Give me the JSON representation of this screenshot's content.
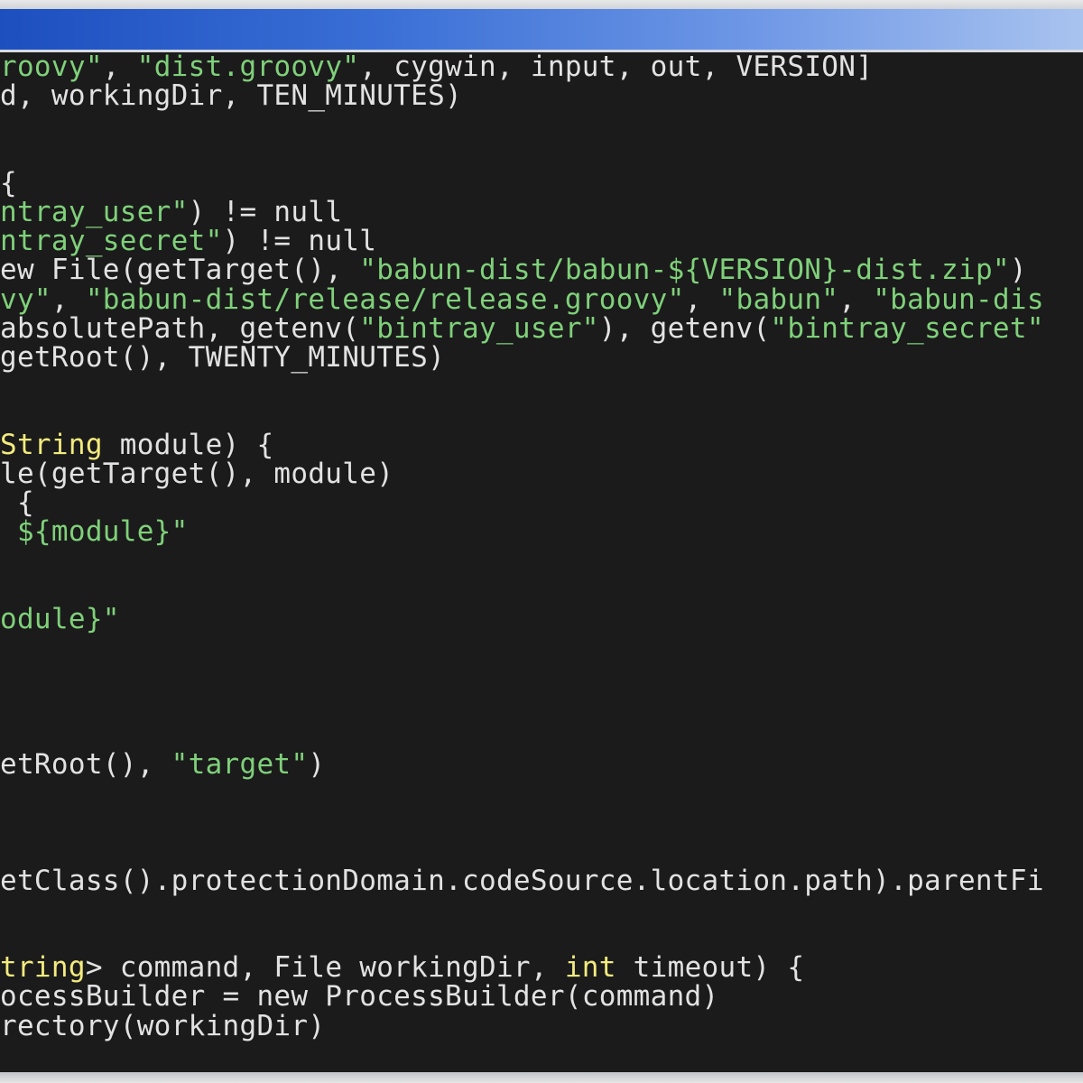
{
  "window": {
    "title": ""
  },
  "colors": {
    "background": "#1b1b1b",
    "default_text": "#e2e2e2",
    "string": "#7fd07a",
    "keyword": "#f3eb7d",
    "titlebar_accent": "#1d4fbf"
  },
  "code_lines": [
    [
      {
        "t": "roovy\"",
        "c": "str"
      },
      {
        "t": ", ",
        "c": "plain"
      },
      {
        "t": "\"dist.groovy\"",
        "c": "str"
      },
      {
        "t": ", cygwin, input, out, VERSION]",
        "c": "plain"
      }
    ],
    [
      {
        "t": "d, workingDir, TEN_MINUTES)",
        "c": "plain"
      }
    ],
    [
      {
        "t": "",
        "c": "plain"
      }
    ],
    [
      {
        "t": "",
        "c": "plain"
      }
    ],
    [
      {
        "t": "{",
        "c": "plain"
      }
    ],
    [
      {
        "t": "ntray_user\"",
        "c": "str"
      },
      {
        "t": ") != null",
        "c": "plain"
      }
    ],
    [
      {
        "t": "ntray_secret\"",
        "c": "str"
      },
      {
        "t": ") != null",
        "c": "plain"
      }
    ],
    [
      {
        "t": "ew File(getTarget(), ",
        "c": "plain"
      },
      {
        "t": "\"babun-dist/babun-${VERSION}-dist.zip\"",
        "c": "str"
      },
      {
        "t": ")",
        "c": "plain"
      }
    ],
    [
      {
        "t": "vy\"",
        "c": "str"
      },
      {
        "t": ", ",
        "c": "plain"
      },
      {
        "t": "\"babun-dist/release/release.groovy\"",
        "c": "str"
      },
      {
        "t": ", ",
        "c": "plain"
      },
      {
        "t": "\"babun\"",
        "c": "str"
      },
      {
        "t": ", ",
        "c": "plain"
      },
      {
        "t": "\"babun-dis",
        "c": "str"
      }
    ],
    [
      {
        "t": "absolutePath, getenv(",
        "c": "plain"
      },
      {
        "t": "\"bintray_user\"",
        "c": "str"
      },
      {
        "t": "), getenv(",
        "c": "plain"
      },
      {
        "t": "\"bintray_secret\"",
        "c": "str"
      }
    ],
    [
      {
        "t": "getRoot(), TWENTY_MINUTES)",
        "c": "plain"
      }
    ],
    [
      {
        "t": "",
        "c": "plain"
      }
    ],
    [
      {
        "t": "",
        "c": "plain"
      }
    ],
    [
      {
        "t": "String",
        "c": "kw"
      },
      {
        "t": " module) {",
        "c": "plain"
      }
    ],
    [
      {
        "t": "le(getTarget(), module)",
        "c": "plain"
      }
    ],
    [
      {
        "t": " {",
        "c": "plain"
      }
    ],
    [
      {
        "t": " ${module}\"",
        "c": "str"
      }
    ],
    [
      {
        "t": "",
        "c": "plain"
      }
    ],
    [
      {
        "t": "",
        "c": "plain"
      }
    ],
    [
      {
        "t": "odule}\"",
        "c": "str"
      }
    ],
    [
      {
        "t": "",
        "c": "plain"
      }
    ],
    [
      {
        "t": "",
        "c": "plain"
      }
    ],
    [
      {
        "t": "",
        "c": "plain"
      }
    ],
    [
      {
        "t": "",
        "c": "plain"
      }
    ],
    [
      {
        "t": "etRoot(), ",
        "c": "plain"
      },
      {
        "t": "\"target\"",
        "c": "str"
      },
      {
        "t": ")",
        "c": "plain"
      }
    ],
    [
      {
        "t": "",
        "c": "plain"
      }
    ],
    [
      {
        "t": "",
        "c": "plain"
      }
    ],
    [
      {
        "t": "",
        "c": "plain"
      }
    ],
    [
      {
        "t": "etClass().protectionDomain.codeSource.location.path).parentFi",
        "c": "plain"
      }
    ],
    [
      {
        "t": "",
        "c": "plain"
      }
    ],
    [
      {
        "t": "",
        "c": "plain"
      }
    ],
    [
      {
        "t": "tring",
        "c": "kw"
      },
      {
        "t": "> command, File workingDir, ",
        "c": "plain"
      },
      {
        "t": "int",
        "c": "kw"
      },
      {
        "t": " timeout) {",
        "c": "plain"
      }
    ],
    [
      {
        "t": "ocessBuilder = new ProcessBuilder(command)",
        "c": "plain"
      }
    ],
    [
      {
        "t": "rectory(workingDir)",
        "c": "plain"
      }
    ]
  ]
}
